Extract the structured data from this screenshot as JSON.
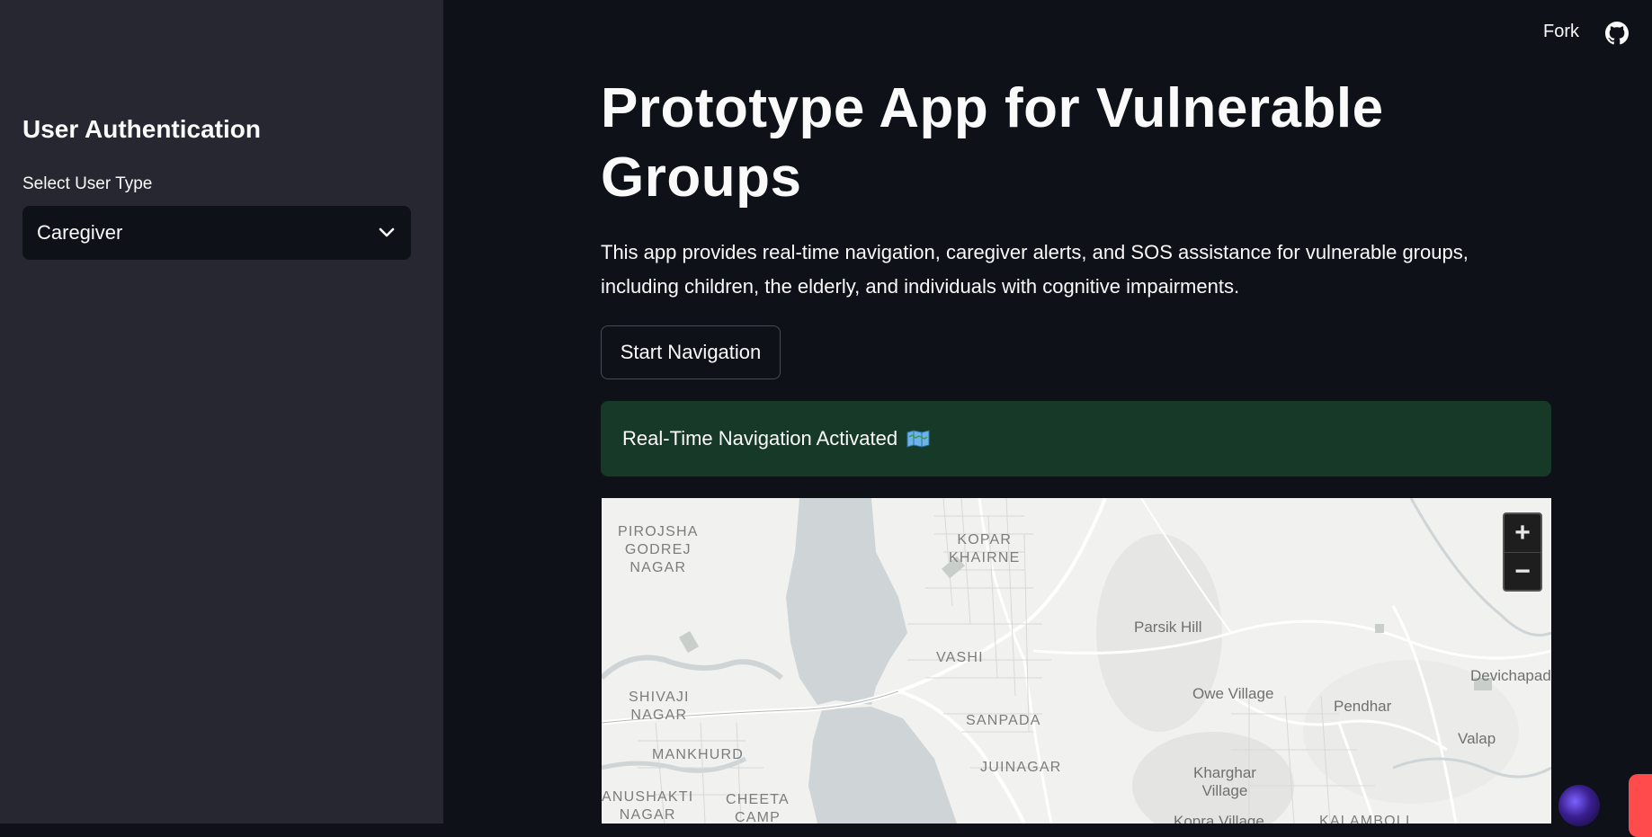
{
  "sidebar": {
    "title": "User Authentication",
    "select_label": "Select User Type",
    "select_value": "Caregiver"
  },
  "toolbar": {
    "fork_label": "Fork"
  },
  "main": {
    "title": "Prototype App for Vulnerable Groups",
    "description": "This app provides real-time navigation, caregiver alerts, and SOS assistance for vulnerable groups, including children, the elderly, and individuals with cognitive impairments.",
    "button_label": "Start Navigation",
    "success_message": "Real-Time Navigation Activated"
  },
  "map": {
    "labels": {
      "pirojsha": "PIROJSHA\nGODREJ\nNAGAR",
      "kopar": "KOPAR\nKHAIRNE",
      "parsik": "Parsik Hill",
      "vashi": "VASHI",
      "devichapada": "Devichapad",
      "shivaji": "SHIVAJI\nNAGAR",
      "owe": "Owe Village",
      "pendhar": "Pendhar",
      "sanpada": "SANPADA",
      "valap": "Valap",
      "mankhurd": "MANKHURD",
      "juinagar": "JUINAGAR",
      "kharghar": "Kharghar\nVillage",
      "anushakti": "ANUSHAKTI\nNAGAR",
      "cheeta": "CHEETA\nCAMP",
      "kopra": "Kopra Village",
      "kalamboli": "KALAMBOLI"
    },
    "zoom_in": "+",
    "zoom_out": "−"
  },
  "colors": {
    "background": "#0e1117",
    "sidebar": "#262730",
    "success_bg": "#173928",
    "water": "#cfd4d6",
    "accent": "#ff4b4b"
  }
}
